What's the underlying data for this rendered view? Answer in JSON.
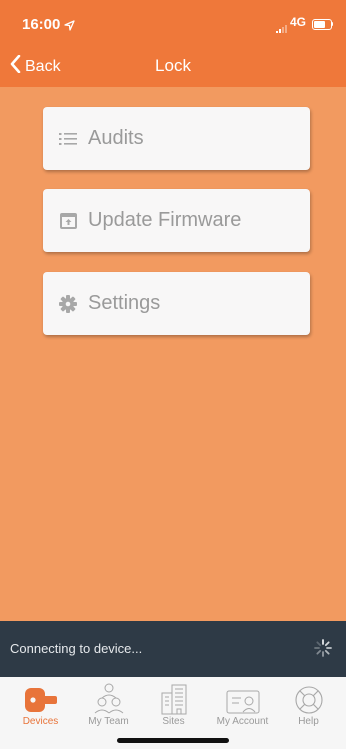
{
  "status_bar": {
    "time": "16:00",
    "network": "4G"
  },
  "nav": {
    "back_label": "Back",
    "title": "Lock"
  },
  "menu": [
    {
      "label": "Audits",
      "icon": "list-icon"
    },
    {
      "label": "Update Firmware",
      "icon": "firmware-upload-icon"
    },
    {
      "label": "Settings",
      "icon": "gear-icon"
    }
  ],
  "connection": {
    "status_text": "Connecting to device..."
  },
  "tabs": [
    {
      "label": "Devices",
      "icon": "lock-device-icon",
      "active": true
    },
    {
      "label": "My Team",
      "icon": "team-icon",
      "active": false
    },
    {
      "label": "Sites",
      "icon": "building-icon",
      "active": false
    },
    {
      "label": "My Account",
      "icon": "account-card-icon",
      "active": false
    },
    {
      "label": "Help",
      "icon": "lifebuoy-icon",
      "active": false
    }
  ],
  "colors": {
    "header": "#ef783a",
    "background": "#f29a60",
    "card": "#f8f7f7",
    "connection_bar": "#2e3a46",
    "tab_active": "#e8743a",
    "tab_inactive": "#9a9a9a"
  }
}
